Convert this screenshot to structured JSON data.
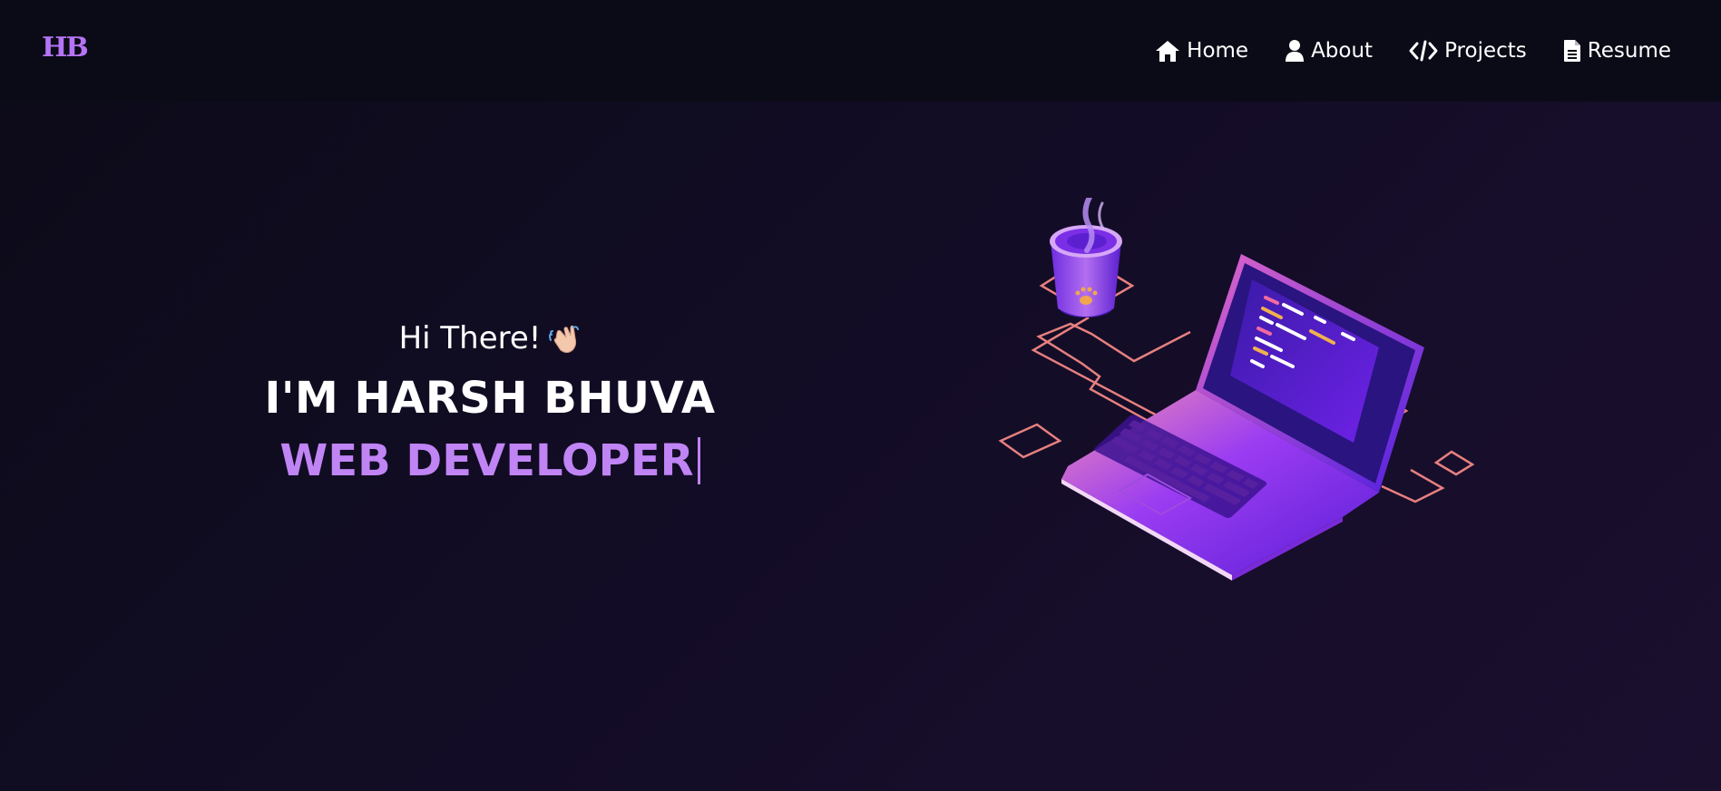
{
  "logo": {
    "text": "HB",
    "icon": "hb-monogram-logo"
  },
  "nav": {
    "items": [
      {
        "label": "Home",
        "icon": "home-icon"
      },
      {
        "label": "About",
        "icon": "user-icon"
      },
      {
        "label": "Projects",
        "icon": "code-icon"
      },
      {
        "label": "Resume",
        "icon": "document-icon"
      }
    ]
  },
  "hero": {
    "greeting": "Hi There!",
    "greeting_icon": "waving-hand-icon",
    "name": "I'M HARSH BHUVA",
    "role": "WEB DEVELOPER",
    "illustration": "laptop-coffee-illustration"
  },
  "colors": {
    "background": "#120c25",
    "navbar": "#0b0b17",
    "accent": "#c084f5",
    "text": "#ffffff",
    "outline": "#e7807f"
  }
}
